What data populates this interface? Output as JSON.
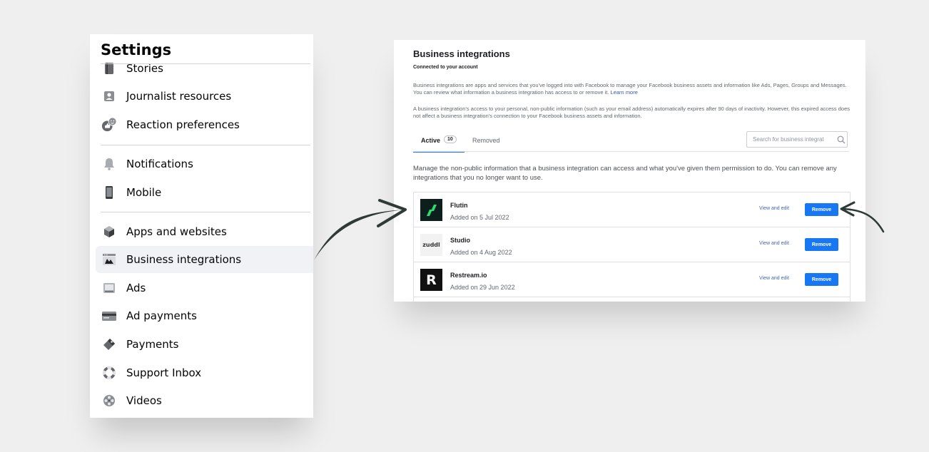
{
  "settings": {
    "title": "Settings",
    "items": [
      {
        "label": "Stories",
        "icon": "stories-icon"
      },
      {
        "label": "Journalist resources",
        "icon": "journalist-icon"
      },
      {
        "label": "Reaction preferences",
        "icon": "reaction-icon"
      },
      {
        "label": "Notifications",
        "icon": "bell-icon"
      },
      {
        "label": "Mobile",
        "icon": "mobile-icon"
      },
      {
        "label": "Apps and websites",
        "icon": "cube-icon"
      },
      {
        "label": "Business integrations",
        "icon": "business-integrations-icon",
        "active": true
      },
      {
        "label": "Ads",
        "icon": "ads-icon"
      },
      {
        "label": "Ad payments",
        "icon": "card-icon"
      },
      {
        "label": "Payments",
        "icon": "tag-icon"
      },
      {
        "label": "Support Inbox",
        "icon": "lifebuoy-icon"
      },
      {
        "label": "Videos",
        "icon": "film-reel-icon"
      }
    ]
  },
  "business": {
    "title": "Business integrations",
    "subtitle": "Connected to your account",
    "intro": "Business integrations are apps and services that you've logged into with Facebook to manage your Facebook business assets and information like Ads, Pages, Groups and Messages. You can review what information a business integration has access to or remove it.",
    "learn_more": "Learn more",
    "expiry_note": "A business integration's access to your personal, non-public information (such as your email address) automatically expires after 90 days of inactivity. However, this expired access does not affect a business integration's connection to your Facebook business assets and information.",
    "tabs": {
      "active_label": "Active",
      "active_count": "10",
      "removed_label": "Removed"
    },
    "search_placeholder": "Search for business integrat",
    "manage_text": "Manage the non-public information that a business integration can access and what you've given them permission to do. You can remove any integrations that you no longer want to use.",
    "integrations": [
      {
        "name": "Flutin",
        "date": "Added on 5 Jul 2022",
        "view_label": "View and edit",
        "remove_label": "Remove",
        "logo_color": "#0d1f1c"
      },
      {
        "name": "Studio",
        "date": "Added on 4 Aug 2022",
        "view_label": "View and edit",
        "remove_label": "Remove",
        "logo_text": "zuddl"
      },
      {
        "name": "Restream.io",
        "date": "Added on 29 Jun 2022",
        "view_label": "View and edit",
        "remove_label": "Remove",
        "logo_text": "R"
      }
    ]
  },
  "colors": {
    "accent": "#1877f2",
    "link": "#4267b2",
    "arrow": "#2f3a36",
    "flutin_green": "#2bdc73"
  }
}
